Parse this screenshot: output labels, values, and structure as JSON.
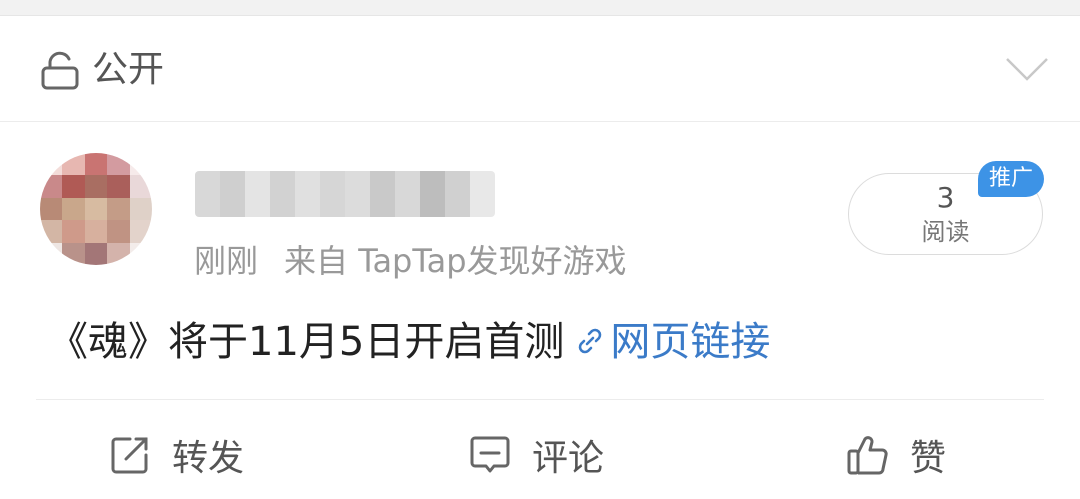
{
  "visibility": {
    "label": "公开",
    "icon": "lock-open-icon",
    "expand_icon": "chevron-down-icon"
  },
  "post": {
    "meta": {
      "time": "刚刚",
      "source": "来自 TapTap发现好游戏"
    },
    "reads": {
      "count": "3",
      "label": "阅读"
    },
    "promo_badge": "推广",
    "text": "《魂》将于11月5日开启首测",
    "link_label": "网页链接",
    "link_icon": "link-icon"
  },
  "actions": {
    "repost_label": "转发",
    "comment_label": "评论",
    "like_label": "赞"
  },
  "colors": {
    "link": "#3b7bc8",
    "badge": "#3d93e6",
    "meta_text": "#999999"
  }
}
